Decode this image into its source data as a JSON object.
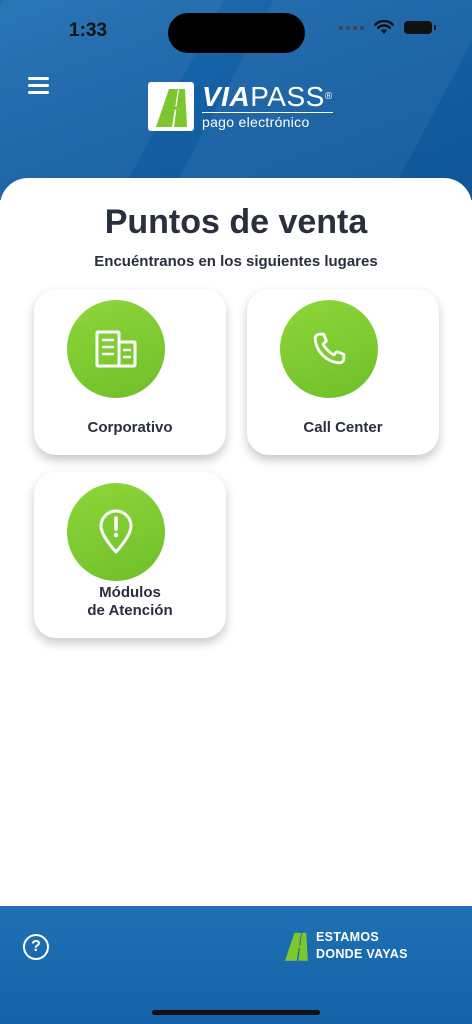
{
  "status_bar": {
    "time": "1:33"
  },
  "header": {
    "logo": {
      "brand_bold": "VIA",
      "brand_light": "PASS",
      "registered": "®",
      "tagline": "pago electrónico"
    }
  },
  "main": {
    "title": "Puntos de venta",
    "subtitle": "Encuéntranos en los siguientes lugares",
    "tiles": [
      {
        "label": "Corporativo",
        "icon": "building-icon"
      },
      {
        "label": "Call Center",
        "icon": "phone-icon"
      },
      {
        "label_line1": "Módulos",
        "label_line2": "de Atención",
        "icon": "location-pin-icon"
      }
    ]
  },
  "footer": {
    "help_symbol": "?",
    "slogan_line1": "ESTAMOS",
    "slogan_line2": "DONDE VAYAS"
  },
  "colors": {
    "primary_blue": "#1560a5",
    "accent_green": "#7cc72f",
    "text_dark": "#2a2f3e"
  }
}
